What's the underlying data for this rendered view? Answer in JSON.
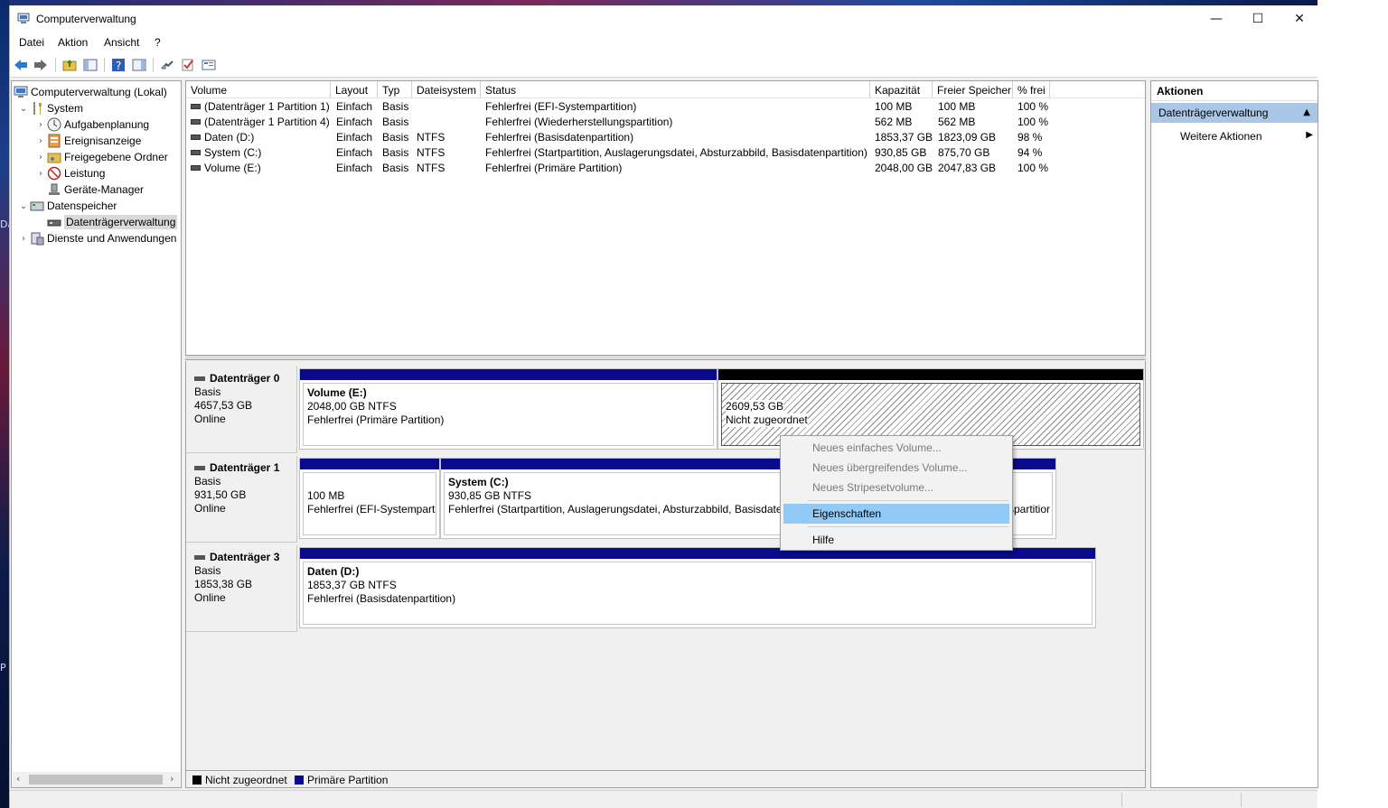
{
  "window": {
    "title": "Computerverwaltung",
    "minimize_glyph": "—",
    "maximize_glyph": "☐",
    "close_glyph": "✕"
  },
  "menu": [
    "Datei",
    "Aktion",
    "Ansicht",
    "?"
  ],
  "toolbar": [
    "back-icon",
    "forward-icon",
    "up-folder-icon",
    "show-hide-tree-icon",
    "help-icon",
    "show-hide-action-pane-icon",
    "connect-icon",
    "check-icon",
    "properties-icon"
  ],
  "tree": {
    "items": [
      {
        "label": "Computerverwaltung (Lokal)",
        "chev": "",
        "indent": 0,
        "icon": "computer-management-icon"
      },
      {
        "label": "System",
        "chev": "⌄",
        "indent": 1,
        "icon": "tools-icon"
      },
      {
        "label": "Aufgabenplanung",
        "chev": "›",
        "indent": 2,
        "icon": "clock-icon"
      },
      {
        "label": "Ereignisanzeige",
        "chev": "›",
        "indent": 2,
        "icon": "event-viewer-icon"
      },
      {
        "label": "Freigegebene Ordner",
        "chev": "›",
        "indent": 2,
        "icon": "shared-folder-icon"
      },
      {
        "label": "Leistung",
        "chev": "›",
        "indent": 2,
        "icon": "performance-icon"
      },
      {
        "label": "Geräte-Manager",
        "chev": "",
        "indent": 2,
        "icon": "device-manager-icon"
      },
      {
        "label": "Datenspeicher",
        "chev": "⌄",
        "indent": 1,
        "icon": "storage-icon"
      },
      {
        "label": "Datenträgerverwaltung",
        "chev": "",
        "indent": 2,
        "icon": "disk-management-icon",
        "selected": true
      },
      {
        "label": "Dienste und Anwendungen",
        "chev": "›",
        "indent": 1,
        "icon": "services-icon"
      }
    ],
    "scroll_left": "‹",
    "scroll_right": "›"
  },
  "volumes": {
    "columns": [
      "Volume",
      "Layout",
      "Typ",
      "Dateisystem",
      "Status",
      "Kapazität",
      "Freier Speicher",
      "% frei"
    ],
    "rows": [
      [
        "(Datenträger 1 Partition 1)",
        "Einfach",
        "Basis",
        "",
        "Fehlerfrei (EFI-Systempartition)",
        "100 MB",
        "100 MB",
        "100 %"
      ],
      [
        "(Datenträger 1 Partition 4)",
        "Einfach",
        "Basis",
        "",
        "Fehlerfrei (Wiederherstellungspartition)",
        "562 MB",
        "562 MB",
        "100 %"
      ],
      [
        "Daten (D:)",
        "Einfach",
        "Basis",
        "NTFS",
        "Fehlerfrei (Basisdatenpartition)",
        "1853,37 GB",
        "1823,09 GB",
        "98 %"
      ],
      [
        "System (C:)",
        "Einfach",
        "Basis",
        "NTFS",
        "Fehlerfrei (Startpartition, Auslagerungsdatei, Absturzabbild, Basisdatenpartition)",
        "930,85 GB",
        "875,70 GB",
        "94 %"
      ],
      [
        "Volume (E:)",
        "Einfach",
        "Basis",
        "NTFS",
        "Fehlerfrei (Primäre Partition)",
        "2048,00 GB",
        "2047,83 GB",
        "100 %"
      ]
    ]
  },
  "disks": [
    {
      "name": "Datenträger 0",
      "type": "Basis",
      "size": "4657,53 GB",
      "state": "Online",
      "partitions": [
        {
          "title": "Volume  (E:)",
          "size": "2048,00 GB NTFS",
          "status": "Fehlerfrei (Primäre Partition)",
          "kind": "primary"
        },
        {
          "title": "",
          "size": "2609,53 GB",
          "status": "Nicht zugeordnet",
          "kind": "unallocated"
        }
      ]
    },
    {
      "name": "Datenträger 1",
      "type": "Basis",
      "size": "931,50 GB",
      "state": "Online",
      "partitions": [
        {
          "title": "",
          "size": "100 MB",
          "status": "Fehlerfrei (EFI-Systempartit",
          "kind": "primary"
        },
        {
          "title": "System  (C:)",
          "size": "930,85 GB NTFS",
          "status": "Fehlerfrei (Startpartition, Auslagerungsdatei, Absturzabbild, Basisdate",
          "kind": "primary"
        },
        {
          "title": "",
          "size": "",
          "status": "spartitior",
          "kind": "primary"
        }
      ]
    },
    {
      "name": "Datenträger 3",
      "type": "Basis",
      "size": "1853,38 GB",
      "state": "Online",
      "partitions": [
        {
          "title": "Daten  (D:)",
          "size": "1853,37 GB NTFS",
          "status": "Fehlerfrei (Basisdatenpartition)",
          "kind": "primary"
        }
      ]
    }
  ],
  "legend": [
    {
      "label": "Nicht zugeordnet",
      "color": "#000000"
    },
    {
      "label": "Primäre Partition",
      "color": "#0a0a8c"
    }
  ],
  "actions": {
    "header": "Aktionen",
    "section": "Datenträgerverwaltung",
    "section_glyph": "▲",
    "item": "Weitere Aktionen",
    "item_glyph": "▶"
  },
  "context_menu": {
    "items": [
      {
        "label": "Neues einfaches Volume...",
        "disabled": true
      },
      {
        "label": "Neues übergreifendes Volume...",
        "disabled": true
      },
      {
        "label": "Neues Stripesetvolume...",
        "disabled": true
      },
      {
        "label": "Eigenschaften",
        "disabled": false,
        "hover": true
      },
      {
        "label": "Hilfe",
        "disabled": false
      }
    ]
  },
  "desktop_glyphs": [
    "Da",
    "P"
  ],
  "colors": {
    "primary_partition": "#0a0a8c",
    "unallocated": "#000000",
    "selection": "#a9c6e6",
    "menu_hover": "#91c9f7"
  }
}
